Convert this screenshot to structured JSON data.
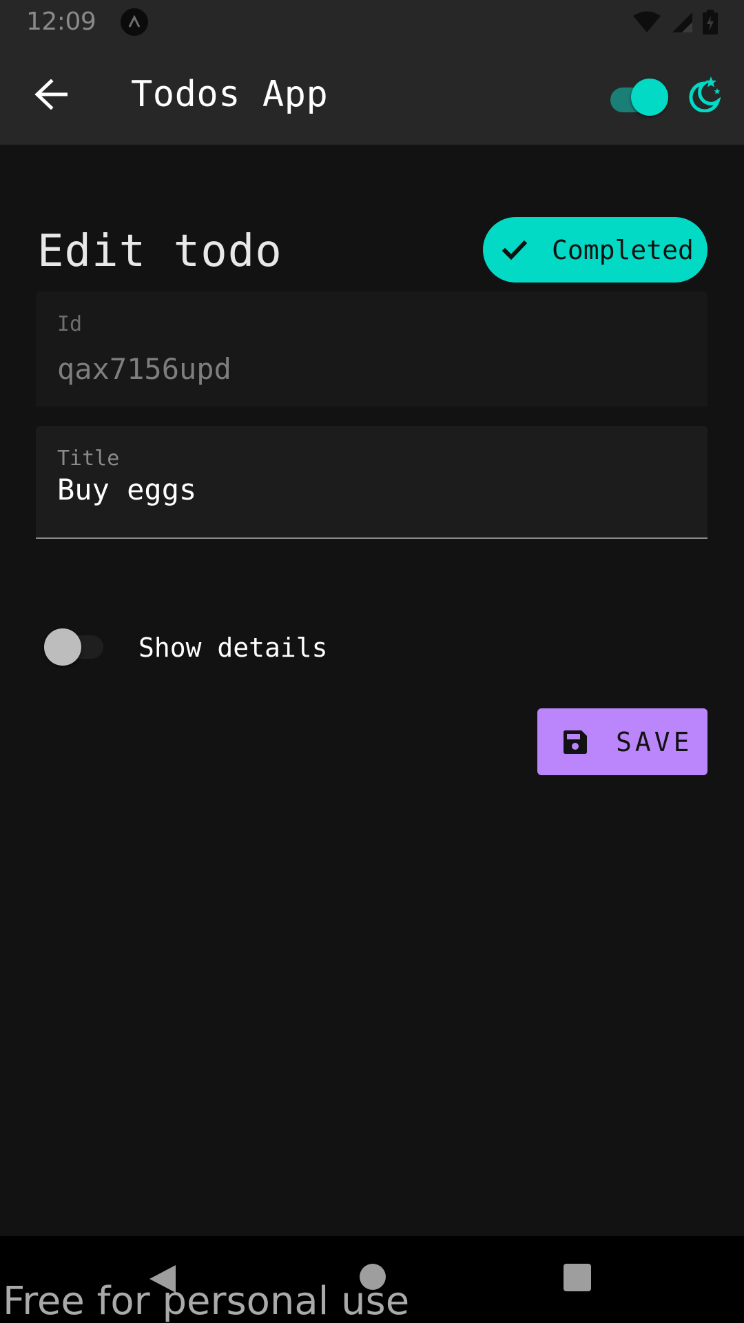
{
  "status_bar": {
    "time": "12:09",
    "icons": [
      "app-notification-icon",
      "wifi-icon",
      "signal-icon",
      "battery-icon"
    ]
  },
  "app_bar": {
    "title": "Todos App",
    "back_icon": "arrow-back-icon",
    "theme_toggle": {
      "checked": true,
      "color": "#03dac6"
    },
    "theme_icon": "moon-stars-icon"
  },
  "page": {
    "heading": "Edit todo",
    "status_chip": {
      "label": "Completed",
      "icon": "check-icon",
      "color": "#03dac6"
    }
  },
  "form": {
    "id_field": {
      "label": "Id",
      "value": "qax7156upd",
      "disabled": true
    },
    "title_field": {
      "label": "Title",
      "value": "Buy eggs"
    },
    "show_details": {
      "label": "Show details",
      "checked": false
    },
    "save_button": {
      "label": "SAVE",
      "icon": "save-disk-icon",
      "color": "#bb86fc"
    }
  },
  "nav_bar": {
    "buttons": [
      "nav-back-icon",
      "nav-home-icon",
      "nav-recents-icon"
    ]
  },
  "watermark": "Free for personal use"
}
